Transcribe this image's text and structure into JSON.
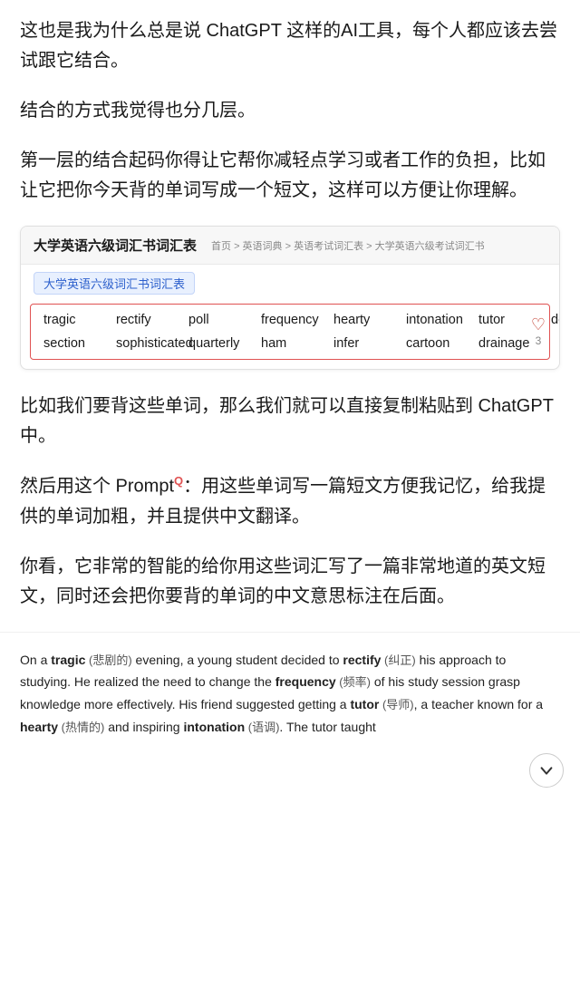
{
  "intro": {
    "para1": "这也是我为什么总是说 ChatGPT 这样的AI工具，每个人都应该去尝试跟它结合。",
    "para2": "结合的方式我觉得也分几层。",
    "para3": "第一层的结合起码你得让它帮你减轻点学习或者工作的负担，比如让它把你今天背的单词写成一个短文，这样可以方便让你理解。"
  },
  "vocab_card": {
    "site_title": "大学英语六级词汇书词汇表",
    "breadcrumb": "首页 > 英语词典 > 英语考试词汇表 > 大学英语六级考试词汇书",
    "tag": "大学英语六级词汇书词汇表",
    "row1": [
      "tragic",
      "rectify",
      "poll",
      "frequency",
      "hearty",
      "intonation",
      "tutor",
      "decorative"
    ],
    "row2": [
      "section",
      "sophisticated",
      "quarterly",
      "ham",
      "infer",
      "cartoon",
      "drainage"
    ],
    "heart": "♡",
    "number": "3"
  },
  "middle": {
    "para1": "比如我们要背这些单词，那么我们就可以直接复制粘贴到 ChatGPT 中。",
    "para2_prefix": "然后用这个 Prompt",
    "para2_superscript": "Q",
    "para2_suffix": "：用这些单词写一篇短文方便我记忆，给我提供的单词加粗，并且提供中文翻译。",
    "para3": "你看，它非常的智能的给你用这些词汇写了一篇非常地道的英文短文，同时还会把你要背的单词的中文意思标注在后面。"
  },
  "article": {
    "text_parts": [
      {
        "type": "text",
        "content": "On a "
      },
      {
        "type": "bold",
        "content": "tragic"
      },
      {
        "type": "cn",
        "content": " (悲剧的)"
      },
      {
        "type": "text",
        "content": " evening, a young student decided to "
      },
      {
        "type": "bold",
        "content": "rectify"
      },
      {
        "type": "cn",
        "content": " (纠正)"
      },
      {
        "type": "text",
        "content": " his approach to studying. He realized the need to change the "
      },
      {
        "type": "bold",
        "content": "frequency"
      },
      {
        "type": "cn",
        "content": " (频率)"
      },
      {
        "type": "text",
        "content": " of his study session grasp knowledge more effectively. His friend suggested getting a "
      },
      {
        "type": "bold",
        "content": "tutor"
      },
      {
        "type": "cn",
        "content": " (导师)"
      },
      {
        "type": "text",
        "content": ", a teacher known for a "
      },
      {
        "type": "bold",
        "content": "hearty"
      },
      {
        "type": "cn",
        "content": " (热情的)"
      },
      {
        "type": "text",
        "content": " and inspiring "
      },
      {
        "type": "bold",
        "content": "intonation"
      },
      {
        "type": "cn",
        "content": " (语调)"
      },
      {
        "type": "text",
        "content": ". The tutor taught"
      }
    ]
  },
  "chevron": {
    "label": "chevron-down"
  }
}
